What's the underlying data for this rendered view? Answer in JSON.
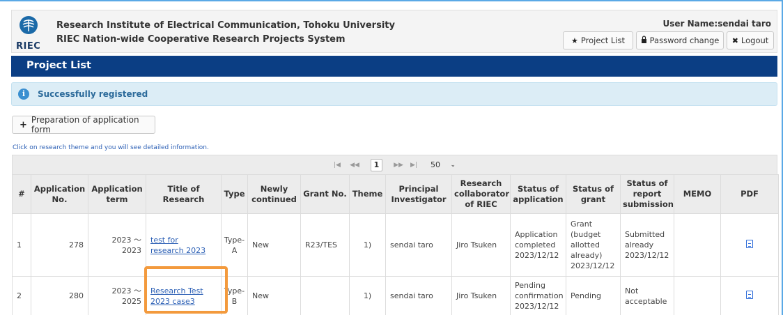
{
  "header": {
    "logo_text": "RIEC",
    "institute_name": "Research Institute of Electrical Communication, Tohoku University",
    "system_name": "RIEC Nation-wide Cooperative Research Projects System",
    "user_name": "User Name:sendai taro",
    "buttons": {
      "project_list": "Project List",
      "password_change": "Password change",
      "logout": "Logout"
    }
  },
  "page": {
    "title": "Project List"
  },
  "alert": {
    "message": "Successfully registered"
  },
  "actions": {
    "prep_button": "Preparation of application form"
  },
  "hint": "Click on research theme and you will see detailed information.",
  "pager": {
    "first": "|◀",
    "prev": "◀◀",
    "current": "1",
    "next": "▶▶",
    "last": "▶|",
    "page_size": "50"
  },
  "table": {
    "headers": {
      "num": "#",
      "app_no": "Application No.",
      "app_term": "Application term",
      "title": "Title of Research",
      "type": "Type",
      "newly": "Newly continued",
      "grant_no": "Grant No.",
      "theme": "Theme",
      "pi": "Principal Investigator",
      "collab": "Research collaborator of RIEC",
      "status_app": "Status of application",
      "status_grant": "Status of grant",
      "status_report": "Status of report submission",
      "memo": "MEMO",
      "pdf": "PDF"
    },
    "rows": [
      {
        "num": "1",
        "app_no": "278",
        "term_start": "2023 ～",
        "term_end": "2023",
        "title_l1": "test for",
        "title_l2": "research 2023",
        "type_l1": "Type-",
        "type_l2": "A",
        "newly": "New",
        "grant_no": "R23/TES",
        "theme": "1)",
        "pi": "sendai taro",
        "collab": "Jiro Tsuken",
        "status_app_l1": "Application",
        "status_app_l2": "completed",
        "status_app_l3": "2023/12/12",
        "status_grant_l1": "Grant",
        "status_grant_l2": "(budget",
        "status_grant_l3": "allotted",
        "status_grant_l4": "already)",
        "status_grant_l5": "2023/12/12",
        "status_report_l1": "Submitted",
        "status_report_l2": "already",
        "status_report_l3": "2023/12/12",
        "memo": ""
      },
      {
        "num": "2",
        "app_no": "280",
        "term_start": "2023 ～",
        "term_end": "2025",
        "title_l1": "Research Test",
        "title_l2": "2023 case3",
        "type_l1": "Type-",
        "type_l2": "B",
        "newly": "New",
        "grant_no": "",
        "theme": "1)",
        "pi": "sendai taro",
        "collab": "Jiro Tsuken",
        "status_app_l1": "Pending",
        "status_app_l2": "confirmation",
        "status_app_l3": "2023/12/12",
        "status_grant_l1": "Pending",
        "status_report_l1": "Not",
        "status_report_l2": "acceptable",
        "memo": ""
      }
    ]
  },
  "colors": {
    "title_bar": "#0b3e84",
    "alert_bg": "#dcedf6",
    "link": "#2b5fb5",
    "highlight": "#f39a3d"
  }
}
